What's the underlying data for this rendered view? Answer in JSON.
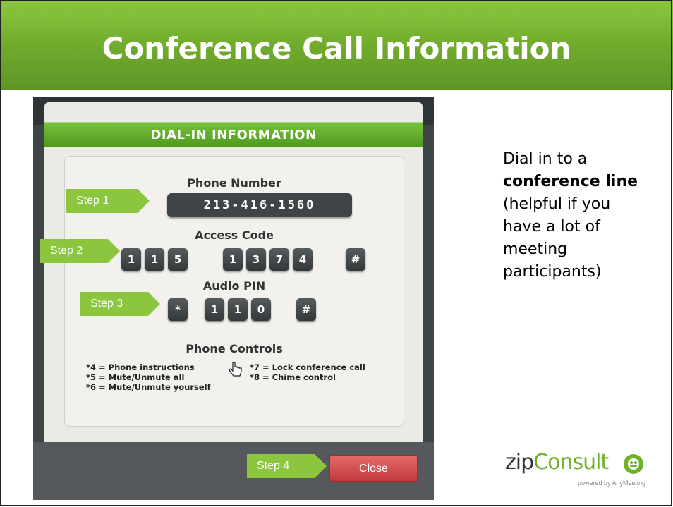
{
  "title": "Conference Call Information",
  "dialog": {
    "header": "DIAL-IN INFORMATION",
    "phone_number_label": "Phone Number",
    "phone_number": "213-416-1560",
    "access_code_label": "Access Code",
    "access_code_keys": [
      "1",
      "1",
      "5",
      "1",
      "3",
      "7",
      "4",
      "#"
    ],
    "audio_pin_label": "Audio PIN",
    "audio_pin_keys": [
      "*",
      "1",
      "1",
      "0",
      "#"
    ],
    "phone_controls_label": "Phone Controls",
    "controls_left": [
      "*4 = Phone instructions",
      "*5 = Mute/Unmute all",
      "*6 = Mute/Unmute yourself"
    ],
    "controls_right": [
      "*7 = Lock conference call",
      "*8 = Chime control"
    ],
    "close_label": "Close"
  },
  "steps": [
    "Step 1",
    "Step 2",
    "Step 3",
    "Step 4"
  ],
  "side_text": {
    "part1": "Dial in to a ",
    "bold": "conference line",
    "part2": " (helpful if you have a lot of meeting participants)"
  },
  "logo": {
    "zip": "zip",
    "consult": "Consult",
    "sub": "powered by AnyMeeting"
  },
  "colors": {
    "accent_green": "#8cc63f",
    "close_red": "#d14b4b",
    "dark_key": "#3f4447"
  }
}
